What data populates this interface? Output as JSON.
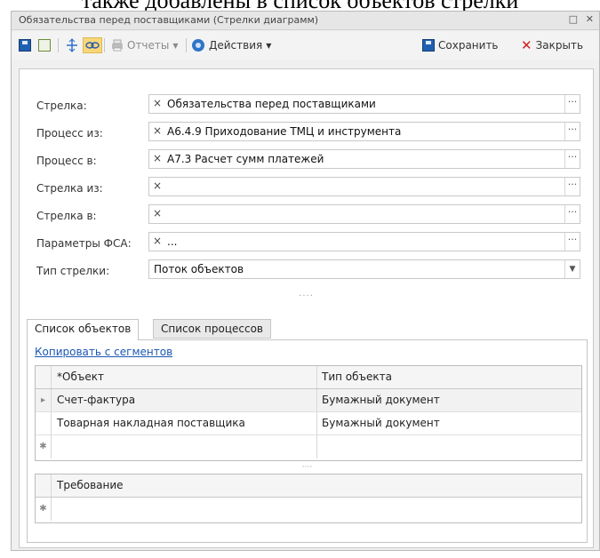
{
  "page_text": "также добавлены в список объектов стрелки",
  "window": {
    "title": "Обязательства перед поставщиками (Стрелки диаграмм)",
    "controls": [
      "□",
      "✕"
    ]
  },
  "toolbar": {
    "reports_label": "Отчеты",
    "actions_label": "Действия",
    "save_label": "Сохранить",
    "close_label": "Закрыть"
  },
  "form": {
    "fields": [
      {
        "label": "Стрелка:",
        "value": "Обязательства перед поставщиками"
      },
      {
        "label": "Процесс из:",
        "value": "А6.4.9 Приходование ТМЦ и инструмента"
      },
      {
        "label": "Процесс в:",
        "value": "А7.3 Расчет сумм платежей"
      },
      {
        "label": "Стрелка из:",
        "value": ""
      },
      {
        "label": "Стрелка в:",
        "value": ""
      },
      {
        "label": "Параметры ФСА:",
        "value": "..."
      }
    ],
    "arrow_type": {
      "label": "Тип стрелки:",
      "value": "Поток объектов"
    }
  },
  "tabs": [
    {
      "label": "Список объектов",
      "active": true
    },
    {
      "label": "Список процессов",
      "active": false
    }
  ],
  "copy_link": "Копировать с сегментов",
  "objects_grid": {
    "columns": [
      "*Объект",
      "Тип объекта"
    ],
    "rows": [
      {
        "object": "Счет-фактура",
        "type": "Бумажный документ"
      },
      {
        "object": "Товарная накладная поставщика",
        "type": "Бумажный документ"
      }
    ]
  },
  "requirements_grid": {
    "columns": [
      "Требование"
    ]
  },
  "glyphs": {
    "clear": "×",
    "ellipsis": "···",
    "dropdown": "▼",
    "row_pointer": "▸",
    "new_row": "✱",
    "splitter": "····"
  },
  "colors": {
    "link": "#1b57b5",
    "close_x": "#d21f1f",
    "save_icon": "#1f5fb0"
  }
}
